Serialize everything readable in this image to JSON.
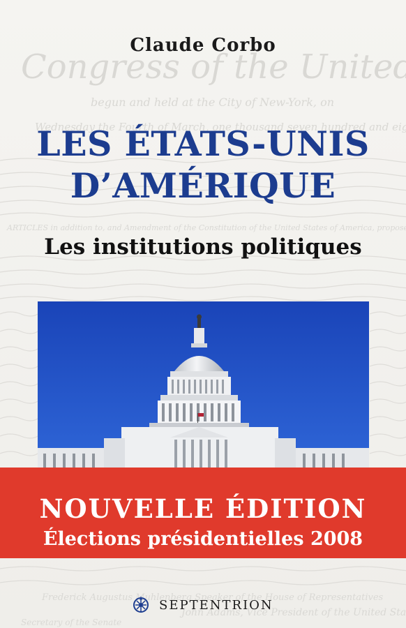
{
  "author": "Claude Corbo",
  "title_line1": "LES ÉTATS-UNIS",
  "title_line2": "D’AMÉRIQUE",
  "subtitle": "Les institutions politiques",
  "banner": {
    "line1": "NOUVELLE ÉDITION",
    "line2": "Élections présidentielles 2008",
    "color": "#e03a2c"
  },
  "publisher": "SEPTENTRION",
  "background_script": {
    "heading": "Congress of the United States",
    "line1": "begun and held at the City of New-York, on",
    "line2": "Wednesday the Fourth of March, one thousand seven hundred and eighty nine",
    "line3": "ARTICLES in addition to, and Amendment of the Constitution of the United States of America, proposed by Congress",
    "footer1": "Frederick Augustus Muhlenberg Speaker of the House of Representatives",
    "footer2": "John Adams, Vice President of the United States, and",
    "footer3": "Secretary of the Senate"
  },
  "colors": {
    "title": "#1c3c8f",
    "sky": "#1f4fc4"
  },
  "image": {
    "subject": "capitol-building-photo"
  }
}
